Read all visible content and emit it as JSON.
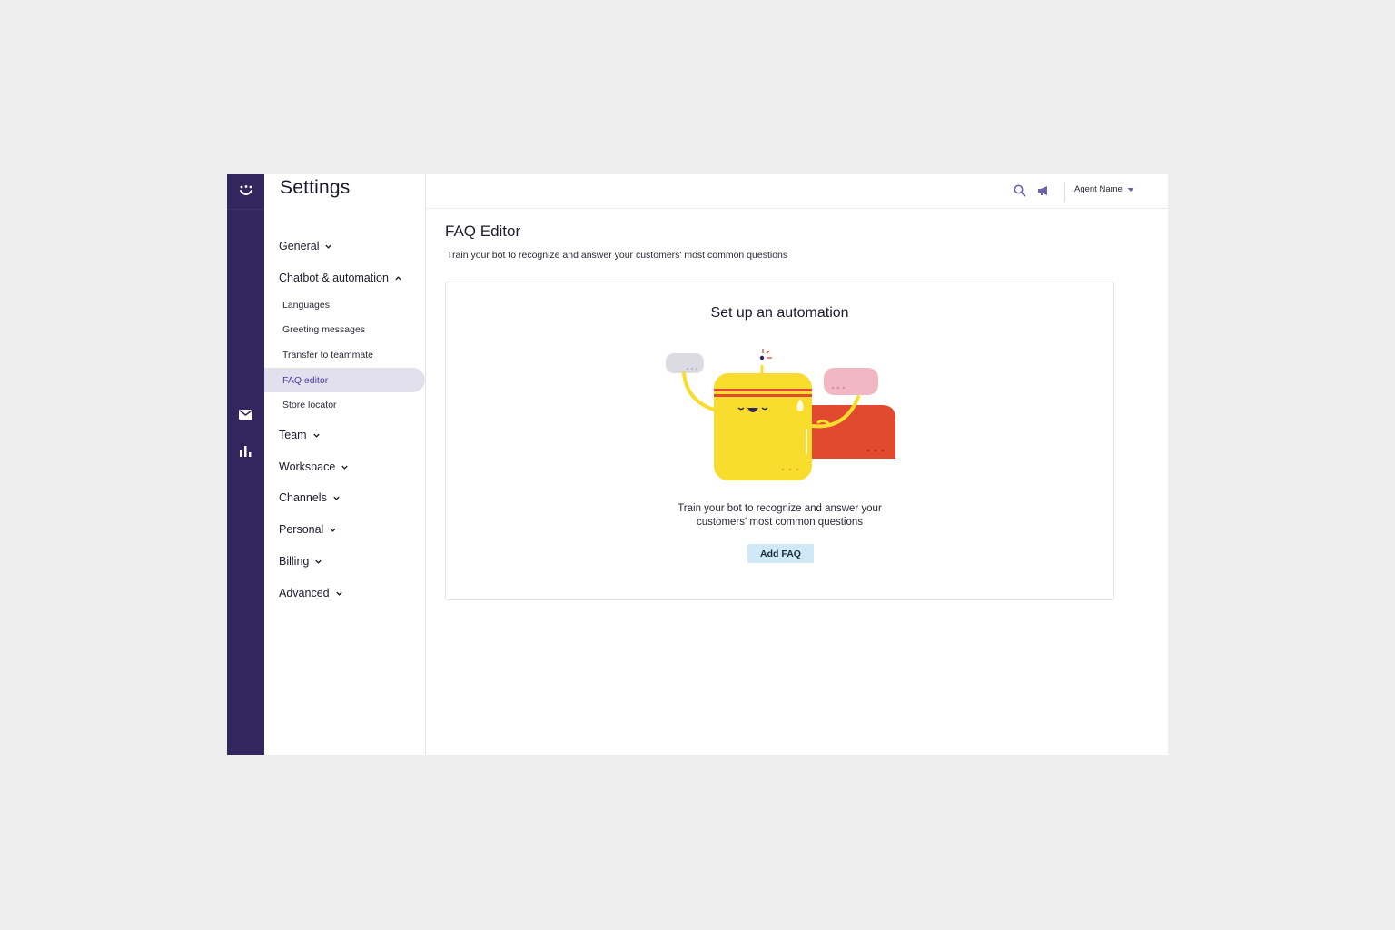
{
  "rail": {
    "icons": [
      "smiley-logo-icon",
      "mail-icon",
      "bar-chart-icon"
    ]
  },
  "sidebar": {
    "title": "Settings",
    "groups": [
      {
        "label": "General",
        "expanded": false
      },
      {
        "label": "Chatbot & automation",
        "expanded": true,
        "items": [
          {
            "label": "Languages"
          },
          {
            "label": "Greeting messages"
          },
          {
            "label": "Transfer to teammate"
          },
          {
            "label": "FAQ editor",
            "active": true
          },
          {
            "label": "Store locator"
          }
        ]
      },
      {
        "label": "Team",
        "expanded": false
      },
      {
        "label": "Workspace",
        "expanded": false
      },
      {
        "label": "Channels",
        "expanded": false
      },
      {
        "label": "Personal",
        "expanded": false
      },
      {
        "label": "Billing",
        "expanded": false
      },
      {
        "label": "Advanced",
        "expanded": false
      }
    ]
  },
  "topbar": {
    "agent_name": "Agent Name",
    "icons": [
      "search-icon",
      "megaphone-icon",
      "caret-down-icon"
    ]
  },
  "main": {
    "title": "FAQ Editor",
    "subtitle": "Train your bot to recognize and answer your customers' most common questions",
    "card": {
      "title": "Set up an automation",
      "desc_line1": "Train your bot to recognize and answer your",
      "desc_line2": "customers' most common questions",
      "button": "Add FAQ"
    }
  },
  "colors": {
    "rail": "#33255e",
    "active_bg": "#e3e0ee",
    "active_text": "#4a3aa0",
    "button_bg": "#cfeaf6",
    "bot_yellow": "#f8dc2e",
    "bubble_red": "#e24a2f",
    "bubble_pink": "#f1b7c2",
    "bubble_grey": "#dcdbe3"
  }
}
